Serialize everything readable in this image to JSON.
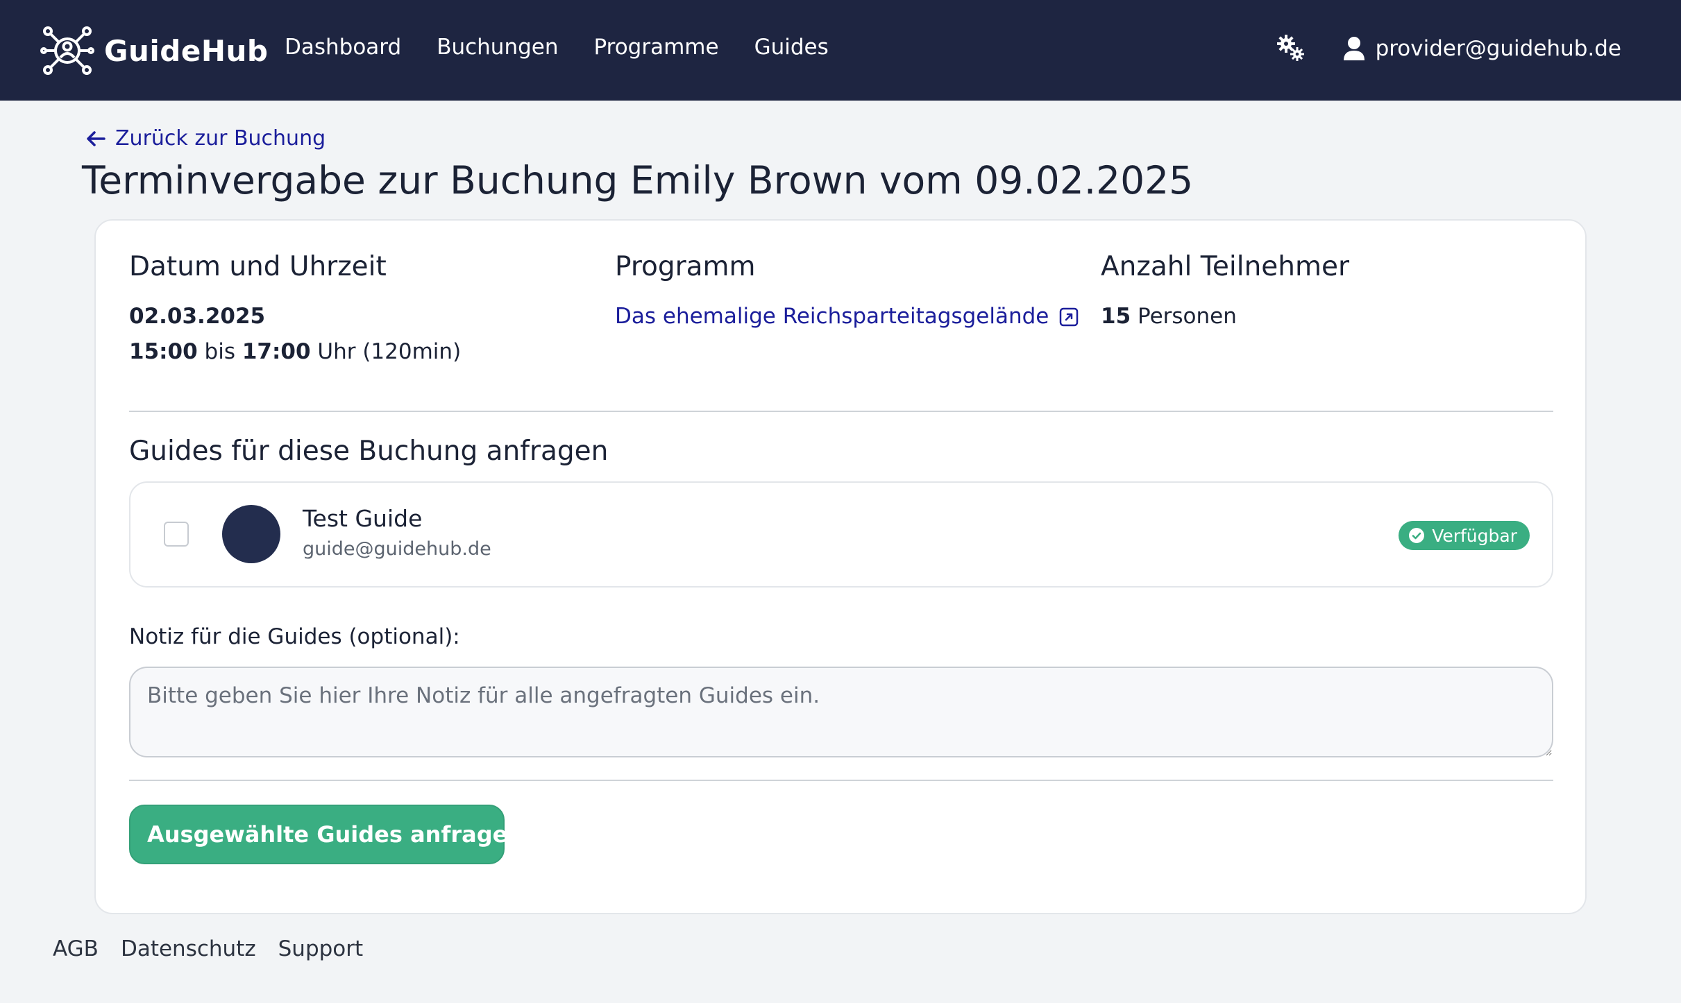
{
  "brand": {
    "name": "GuideHub"
  },
  "nav": {
    "links": [
      "Dashboard",
      "Buchungen",
      "Programme",
      "Guides"
    ],
    "user_email": "provider@guidehub.de"
  },
  "header": {
    "back_label": "Zurück zur Buchung",
    "title": "Terminvergabe zur Buchung Emily Brown vom 09.02.2025"
  },
  "booking": {
    "datetime": {
      "heading": "Datum und Uhrzeit",
      "date": "02.03.2025",
      "start": "15:00",
      "between": "bis",
      "end": "17:00",
      "suffix": "Uhr (120min)"
    },
    "program": {
      "heading": "Programm",
      "name": "Das ehemalige Reichsparteitagsgelände"
    },
    "participants": {
      "heading": "Anzahl Teilnehmer",
      "count": "15",
      "unit": "Personen"
    }
  },
  "guides": {
    "section_title": "Guides für diese Buchung anfragen",
    "items": [
      {
        "name": "Test Guide",
        "email": "guide@guidehub.de",
        "status": "Verfügbar",
        "checked": false,
        "avatar_color": "#232d4e"
      }
    ]
  },
  "note": {
    "label": "Notiz für die Guides (optional):",
    "placeholder": "Bitte geben Sie hier Ihre Notiz für alle angefragten Guides ein.",
    "value": ""
  },
  "submit": {
    "label": "Ausgewählte Guides anfragen"
  },
  "footer": {
    "links": [
      "AGB",
      "Datenschutz",
      "Support"
    ]
  },
  "colors": {
    "navbar": "#1e2541",
    "accent_green": "#3aae82",
    "link_blue": "#1b1e9b",
    "page_bg": "#f2f4f6"
  },
  "icons": {
    "brand": "network-logo-icon",
    "settings": "gears-icon",
    "user": "user-icon",
    "back": "arrow-left-icon",
    "external": "external-link-icon",
    "badge": "check-circle-icon",
    "submit": "chevron-right-icon"
  }
}
